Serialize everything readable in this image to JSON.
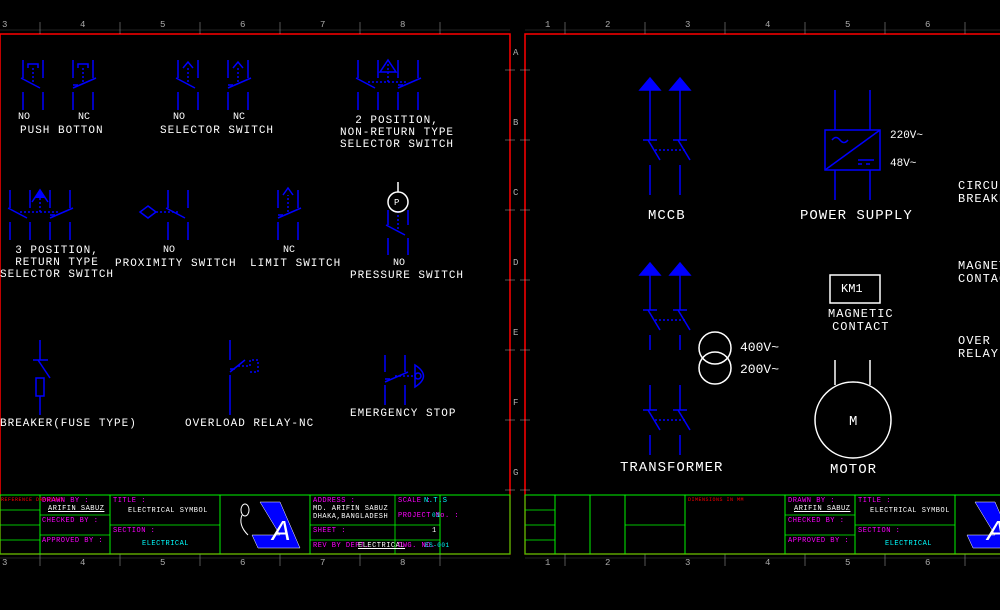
{
  "grid_numbers_left": [
    "3",
    "4",
    "5",
    "6",
    "7",
    "8"
  ],
  "grid_numbers_right": [
    "1",
    "2",
    "3",
    "4",
    "5",
    "6"
  ],
  "grid_letters": [
    "A",
    "B",
    "C",
    "D",
    "E",
    "F",
    "G"
  ],
  "symbols_left": {
    "push_button": {
      "no": "NO",
      "nc": "NC",
      "title": "PUSH BOTTON"
    },
    "selector_switch": {
      "no": "NO",
      "nc": "NC",
      "title": "SELECTOR SWITCH"
    },
    "two_pos": {
      "title": "2 POSITION,\nNON-RETURN TYPE\nSELECTOR SWITCH"
    },
    "three_pos": {
      "title": "3 POSITION,\nRETURN TYPE\nSELECTOR SWITCH"
    },
    "proximity": {
      "no": "NO",
      "title": "PROXIMITY SWITCH"
    },
    "limit": {
      "nc": "NC",
      "title": "LIMIT SWITCH"
    },
    "pressure": {
      "no": "NO",
      "title": "PRESSURE SWITCH",
      "p": "P"
    },
    "breaker": {
      "title": "BREAKER(FUSE TYPE)"
    },
    "overload": {
      "title": "OVERLOAD RELAY-NC"
    },
    "estop": {
      "title": "EMERGENCY STOP"
    }
  },
  "symbols_right": {
    "mccb": {
      "title": "MCCB"
    },
    "power_supply": {
      "title": "POWER SUPPLY",
      "v1": "220V~",
      "v2": "48V~"
    },
    "circuit_breaker": {
      "title": "CIRCUI\nBREAKE"
    },
    "transformer": {
      "title": "TRANSFORMER",
      "v1": "400V~",
      "v2": "200V~"
    },
    "magnetic_contact": {
      "title": "MAGNETIC\nCONTACT",
      "km": "KM1"
    },
    "magnetic_contactor": {
      "title": "MAGNETI\nCONTACT"
    },
    "motor": {
      "title": "MOTOR",
      "m": "M"
    },
    "overload_relay": {
      "title": "OVER LOA\nRELAY"
    }
  },
  "titleblock": {
    "drawn_by_label": "DRAWN BY :",
    "drawn_by": "ARIFIN SABUZ",
    "checked_by": "CHECKED BY :",
    "approved_by": "APPROVED BY :",
    "title_label": "TITLE :",
    "title": "ELECTRICAL SYMBOL",
    "section_label": "SECTION :",
    "section": "ELECTRICAL",
    "address_label": "ADDRESS :",
    "address": "MD. ARIFIN SABUZ\nDHAKA,BANGLADESH",
    "scale_label": "SCALE :",
    "scale": "N.T.S",
    "project_label": "PROJECT No. :",
    "project": "01",
    "sheet_label": "SHEET :",
    "sheet": "1",
    "rev_label": "REV BY DEPT.",
    "rev_dept": "ELECTRICAL",
    "dwg_label": "DWG. NO.",
    "dwg": "ES-001",
    "ref_label": "REFERENCE DRAWINGS",
    "dim_label": "DIMENSIONS IN MM"
  }
}
